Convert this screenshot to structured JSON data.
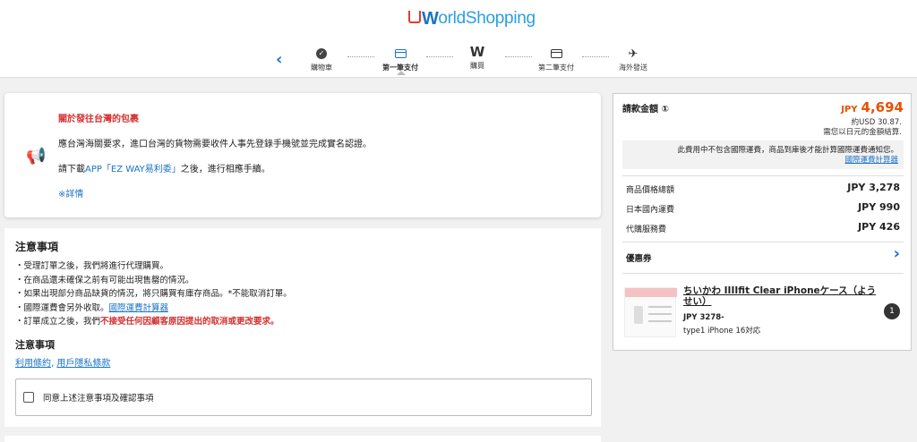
{
  "header": {
    "logo_prefix": "W",
    "logo_rest": "orldShopping",
    "steps": [
      {
        "label": "購物車"
      },
      {
        "label": "第一筆支付"
      },
      {
        "label": "購買"
      },
      {
        "label": "第二筆支付"
      },
      {
        "label": "海外發送"
      }
    ]
  },
  "notice": {
    "title": "關於發往台灣的包裹",
    "line1": "應台灣海關要求，進口台灣的貨物需要收件人事先登錄手機號並完成實名認證。",
    "line2_prefix": "請下載",
    "line2_app": "APP「EZ WAY易利委」",
    "line2_suffix": "之後，進行相應手續。",
    "more": "※詳情"
  },
  "terms": {
    "title": "注意事項",
    "items": [
      "受理訂單之後，我們將進行代理購買。",
      "在商品還未確保之前有可能出現售罄的情況。",
      "如果出現部分商品缺貨的情況，將只購買有庫存商品。*不能取消訂單。",
      "國際運費會另外收取。"
    ],
    "item4_link": "國際運費計算器",
    "item5_prefix": "訂單成立之後，我們",
    "item5_red": "不接受任何因顧客原因提出的取消或更改要求。",
    "subtitle": "注意事項",
    "link_terms": "利用條約",
    "link_sep": ",",
    "link_privacy": "用戶隱私條款",
    "agree_label": "同意上述注意事項及確認事項"
  },
  "summary": {
    "total_label": "請款金額 ①",
    "total_currency": "JPY",
    "total_value": "4,694",
    "usd_line": "約USD 30.87.",
    "usd_note": "需您以日元的金額結算.",
    "ship_note": "此費用中不包含國際運費，商品到庫後才能計算國際運費通知您。",
    "ship_link": "國際運費計算器",
    "rows": [
      {
        "label": "商品價格總額",
        "value": "JPY 3,278"
      },
      {
        "label": "日本國內運費",
        "value": "JPY 990"
      },
      {
        "label": "代購服務費",
        "value": "JPY 426"
      }
    ],
    "coupon_label": "優惠券",
    "item": {
      "name": "ちいかわ IIIIfit Clear iPhoneケース（ようせい）",
      "price": "JPY 3278-",
      "variant": "type1 iPhone 16対応",
      "qty": "1"
    }
  },
  "colors": {
    "accent": "#1a73c8",
    "warning": "#d32f2f",
    "total": "#e65100"
  }
}
